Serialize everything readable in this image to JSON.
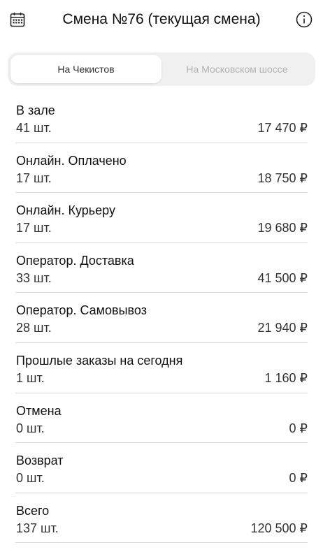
{
  "header": {
    "title": "Смена №76 (текущая смена)",
    "calendar_icon": "calendar-icon",
    "info_icon": "info-icon"
  },
  "tabs": [
    {
      "label": "На Чекистов",
      "active": true
    },
    {
      "label": "На Московском шоссе",
      "active": false
    }
  ],
  "rows": [
    {
      "name": "В зале",
      "count": "41 шт.",
      "amount": "17 470 ₽"
    },
    {
      "name": "Онлайн. Оплачено",
      "count": "17 шт.",
      "amount": "18 750 ₽"
    },
    {
      "name": "Онлайн. Курьеру",
      "count": "17 шт.",
      "amount": "19 680 ₽"
    },
    {
      "name": "Оператор. Доставка",
      "count": "33 шт.",
      "amount": "41 500 ₽"
    },
    {
      "name": "Оператор. Самовывоз",
      "count": "28 шт.",
      "amount": "21 940 ₽"
    },
    {
      "name": "Прошлые заказы на сегодня",
      "count": "1 шт.",
      "amount": "1 160 ₽"
    },
    {
      "name": "Отмена",
      "count": "0 шт.",
      "amount": "0 ₽"
    },
    {
      "name": "Возврат",
      "count": "0 шт.",
      "amount": "0 ₽"
    },
    {
      "name": "Всего",
      "count": "137 шт.",
      "amount": "120 500 ₽"
    }
  ]
}
